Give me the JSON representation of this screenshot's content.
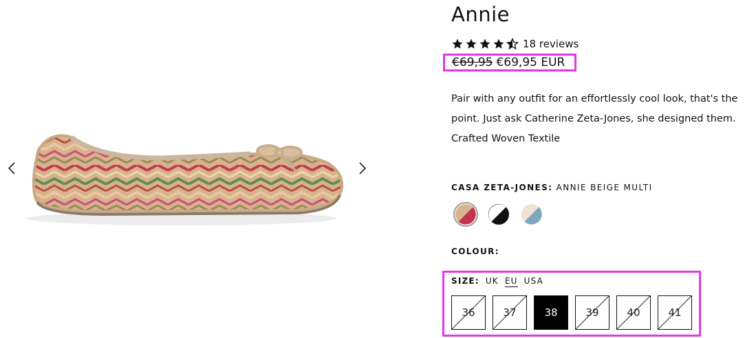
{
  "gallery": {
    "prev_icon": "chevron-left-icon",
    "next_icon": "chevron-right-icon"
  },
  "product": {
    "title": "Annie",
    "rating": 4.5,
    "reviews_label": "18 reviews",
    "price_compare": "€69,95",
    "price": "€69,95 EUR",
    "description": [
      "Pair with any outfit for an effortlessly cool look, that's the point. Just ask Catherine Zeta-Jones, she designed them.",
      "Crafted Woven Textile"
    ],
    "variant_key": "CASA ZETA-JONES:",
    "variant_value": "ANNIE BEIGE MULTI",
    "swatches": [
      {
        "name": "beige-red",
        "color_a": "#d7b58e",
        "color_b": "#c4334f",
        "selected": true
      },
      {
        "name": "black-white",
        "color_a": "#111111",
        "color_b": "#ffffff",
        "selected": false
      },
      {
        "name": "cream-blue",
        "color_a": "#efe3d3",
        "color_b": "#7ea6bd",
        "selected": false
      }
    ],
    "colour_label": "COLOUR:",
    "size": {
      "label": "SIZE:",
      "units": [
        "UK",
        "EU",
        "USA"
      ],
      "active_unit": "EU",
      "options": [
        {
          "value": "36",
          "available": false,
          "selected": false
        },
        {
          "value": "37",
          "available": false,
          "selected": false
        },
        {
          "value": "38",
          "available": true,
          "selected": true
        },
        {
          "value": "39",
          "available": false,
          "selected": false
        },
        {
          "value": "40",
          "available": false,
          "selected": false
        },
        {
          "value": "41",
          "available": false,
          "selected": false
        }
      ]
    }
  },
  "colors": {
    "highlight": "#e436e8",
    "text": "#111111",
    "selected_size_bg": "#000000"
  }
}
